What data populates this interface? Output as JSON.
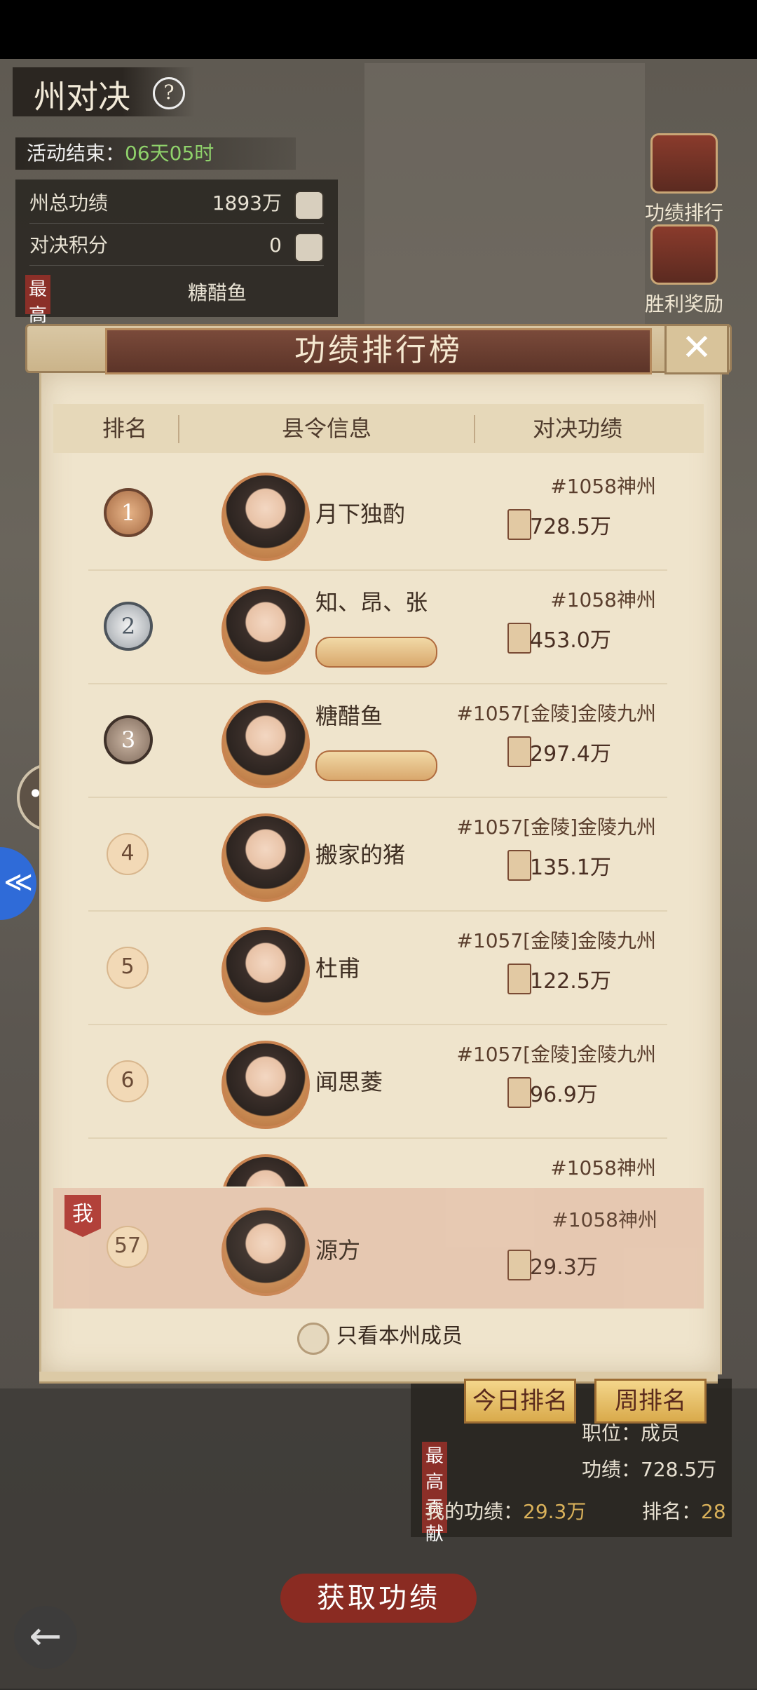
{
  "hud": {
    "title": "州对决",
    "help_icon": "?",
    "timer_label": "活动结束：",
    "timer_value": "06天05时",
    "rows": [
      {
        "label": "州总功绩",
        "value": "1893万"
      },
      {
        "label": "对决积分",
        "value": "0"
      }
    ],
    "top_contributor_tag": "最高",
    "top_contributor_name": "糖醋鱼"
  },
  "side": {
    "merit_rank_label": "功绩排行",
    "victory_reward_label": "胜利奖励"
  },
  "dialog": {
    "title": "功绩排行榜",
    "close_icon": "✕",
    "columns": {
      "rank": "排名",
      "info": "县令信息",
      "merit": "对决功绩"
    },
    "rows": [
      {
        "rank": "1",
        "name": "月下独酌",
        "server": "#1058神州",
        "score": "728.5万"
      },
      {
        "rank": "2",
        "name": "知、昂、张",
        "server": "#1058神州",
        "score": "453.0万"
      },
      {
        "rank": "3",
        "name": "糖醋鱼",
        "server": "#1057[金陵]金陵九州",
        "score": "297.4万"
      },
      {
        "rank": "4",
        "name": "搬家的猪",
        "server": "#1057[金陵]金陵九州",
        "score": "135.1万"
      },
      {
        "rank": "5",
        "name": "杜甫",
        "server": "#1057[金陵]金陵九州",
        "score": "122.5万"
      },
      {
        "rank": "6",
        "name": "闻思菱",
        "server": "#1057[金陵]金陵九州",
        "score": "96.9万"
      }
    ],
    "partial_row_server": "#1058神州",
    "my_row": {
      "tag": "我",
      "rank": "57",
      "name": "源方",
      "server": "#1058神州",
      "score": "29.3万"
    },
    "filter_label": "只看本州成员"
  },
  "tabs": {
    "today": "今日排名",
    "weekly": "周排名"
  },
  "stats": {
    "vertical_tag": "最高贡献",
    "position": "职位：成员",
    "merit": "功绩：728.5万",
    "my_merit_label": "我的功绩：",
    "my_merit_value": "29.3万",
    "my_rank_label": "排名：",
    "my_rank_value": "28"
  },
  "get_merit_button": "获取功绩",
  "back_icon": "←",
  "chat_icon": "•••",
  "float_icon": "≪"
}
